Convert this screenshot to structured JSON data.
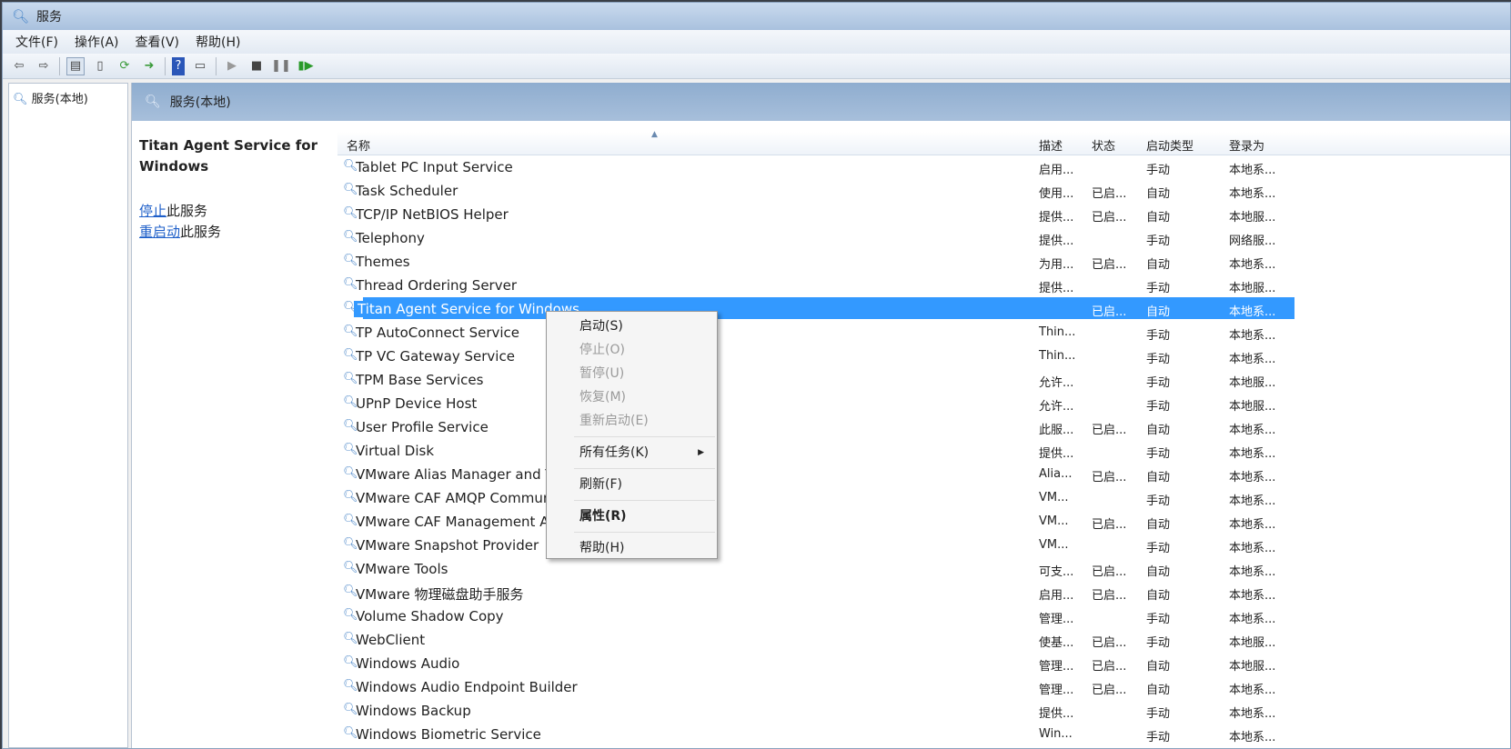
{
  "window": {
    "title": "服务"
  },
  "menubar": [
    "文件(F)",
    "操作(A)",
    "查看(V)",
    "帮助(H)"
  ],
  "tree": {
    "root": "服务(本地)"
  },
  "panel": {
    "title": "服务(本地)"
  },
  "detail": {
    "service_name": "Titan Agent Service for Windows",
    "stop_link": "停止",
    "stop_suffix": "此服务",
    "restart_link": "重启动",
    "restart_suffix": "此服务"
  },
  "columns": [
    "名称",
    "描述",
    "状态",
    "启动类型",
    "登录为"
  ],
  "rows": [
    {
      "name": "Tablet PC Input Service",
      "desc": "启用...",
      "status": "",
      "startup": "手动",
      "logon": "本地系..."
    },
    {
      "name": "Task Scheduler",
      "desc": "使用...",
      "status": "已启...",
      "startup": "自动",
      "logon": "本地系..."
    },
    {
      "name": "TCP/IP NetBIOS Helper",
      "desc": "提供...",
      "status": "已启...",
      "startup": "自动",
      "logon": "本地服..."
    },
    {
      "name": "Telephony",
      "desc": "提供...",
      "status": "",
      "startup": "手动",
      "logon": "网络服..."
    },
    {
      "name": "Themes",
      "desc": "为用...",
      "status": "已启...",
      "startup": "自动",
      "logon": "本地系..."
    },
    {
      "name": "Thread Ordering Server",
      "desc": "提供...",
      "status": "",
      "startup": "手动",
      "logon": "本地服..."
    },
    {
      "name": "Titan Agent Service for Windows",
      "desc": "",
      "status": "已启...",
      "startup": "自动",
      "logon": "本地系..."
    },
    {
      "name": "TP AutoConnect Service",
      "desc": "Thin...",
      "status": "",
      "startup": "手动",
      "logon": "本地系..."
    },
    {
      "name": "TP VC Gateway Service",
      "desc": "Thin...",
      "status": "",
      "startup": "手动",
      "logon": "本地系..."
    },
    {
      "name": "TPM Base Services",
      "desc": "允许...",
      "status": "",
      "startup": "手动",
      "logon": "本地服..."
    },
    {
      "name": "UPnP Device Host",
      "desc": "允许...",
      "status": "",
      "startup": "手动",
      "logon": "本地服..."
    },
    {
      "name": "User Profile Service",
      "desc": "此服...",
      "status": "已启...",
      "startup": "自动",
      "logon": "本地系..."
    },
    {
      "name": "Virtual Disk",
      "desc": "提供...",
      "status": "",
      "startup": "手动",
      "logon": "本地系..."
    },
    {
      "name": "VMware Alias Manager and Ticket Service",
      "desc": "Alia...",
      "status": "已启...",
      "startup": "自动",
      "logon": "本地系..."
    },
    {
      "name": "VMware CAF AMQP Communication Service",
      "desc": "VM...",
      "status": "",
      "startup": "手动",
      "logon": "本地系..."
    },
    {
      "name": "VMware CAF Management Agent Service",
      "desc": "VM...",
      "status": "已启...",
      "startup": "自动",
      "logon": "本地系..."
    },
    {
      "name": "VMware Snapshot Provider",
      "desc": "VM...",
      "status": "",
      "startup": "手动",
      "logon": "本地系..."
    },
    {
      "name": "VMware Tools",
      "desc": "可支...",
      "status": "已启...",
      "startup": "自动",
      "logon": "本地系..."
    },
    {
      "name": "VMware 物理磁盘助手服务",
      "desc": "启用...",
      "status": "已启...",
      "startup": "自动",
      "logon": "本地系..."
    },
    {
      "name": "Volume Shadow Copy",
      "desc": "管理...",
      "status": "",
      "startup": "手动",
      "logon": "本地系..."
    },
    {
      "name": "WebClient",
      "desc": "使基...",
      "status": "已启...",
      "startup": "手动",
      "logon": "本地服..."
    },
    {
      "name": "Windows Audio",
      "desc": "管理...",
      "status": "已启...",
      "startup": "自动",
      "logon": "本地服..."
    },
    {
      "name": "Windows Audio Endpoint Builder",
      "desc": "管理...",
      "status": "已启...",
      "startup": "自动",
      "logon": "本地系..."
    },
    {
      "name": "Windows Backup",
      "desc": "提供...",
      "status": "",
      "startup": "手动",
      "logon": "本地系..."
    },
    {
      "name": "Windows Biometric Service",
      "desc": "Win...",
      "status": "",
      "startup": "手动",
      "logon": "本地系..."
    }
  ],
  "selected_index": 6,
  "context_menu": [
    {
      "label": "启动(S)",
      "state": "enabled"
    },
    {
      "label": "停止(O)",
      "state": "disabled"
    },
    {
      "label": "暂停(U)",
      "state": "disabled"
    },
    {
      "label": "恢复(M)",
      "state": "disabled"
    },
    {
      "label": "重新启动(E)",
      "state": "disabled"
    },
    {
      "label": "所有任务(K)",
      "state": "submenu"
    },
    {
      "label": "刷新(F)",
      "state": "enabled"
    },
    {
      "label": "属性(R)",
      "state": "default"
    },
    {
      "label": "帮助(H)",
      "state": "enabled"
    }
  ]
}
